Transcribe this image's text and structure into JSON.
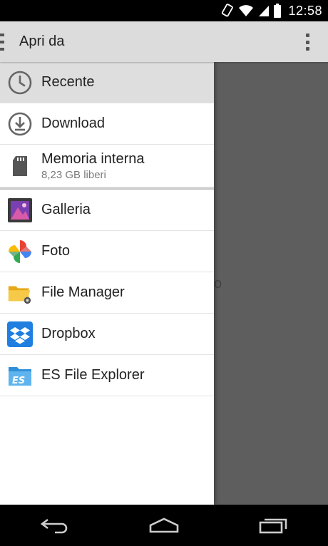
{
  "status": {
    "time": "12:58",
    "icons": [
      "rotate-icon",
      "wifi-icon",
      "signal-icon",
      "battery-icon"
    ]
  },
  "action_bar": {
    "title": "Apri da",
    "menu_icon": "hamburger-icon",
    "overflow_icon": "overflow-menu-icon"
  },
  "roots": [
    {
      "label": "Recente",
      "icon": "clock-icon",
      "selected": true
    },
    {
      "label": "Download",
      "icon": "download-icon"
    },
    {
      "label": "Memoria interna",
      "sub": "8,23 GB liberi",
      "icon": "sd-card-icon"
    }
  ],
  "apps": [
    {
      "label": "Galleria",
      "icon": "gallery-icon"
    },
    {
      "label": "Foto",
      "icon": "photos-pinwheel-icon"
    },
    {
      "label": "File Manager",
      "icon": "folder-gear-icon"
    },
    {
      "label": "Dropbox",
      "icon": "dropbox-icon"
    },
    {
      "label": "ES File Explorer",
      "icon": "es-file-explorer-icon"
    }
  ],
  "scrim": {
    "peek_text": "o"
  },
  "nav": [
    "back-icon",
    "home-icon",
    "recents-icon"
  ],
  "colors": {
    "action_bar": "#dcdcdc",
    "scrim": "#5e5e5e",
    "dropbox_blue": "#1f7fe0"
  }
}
